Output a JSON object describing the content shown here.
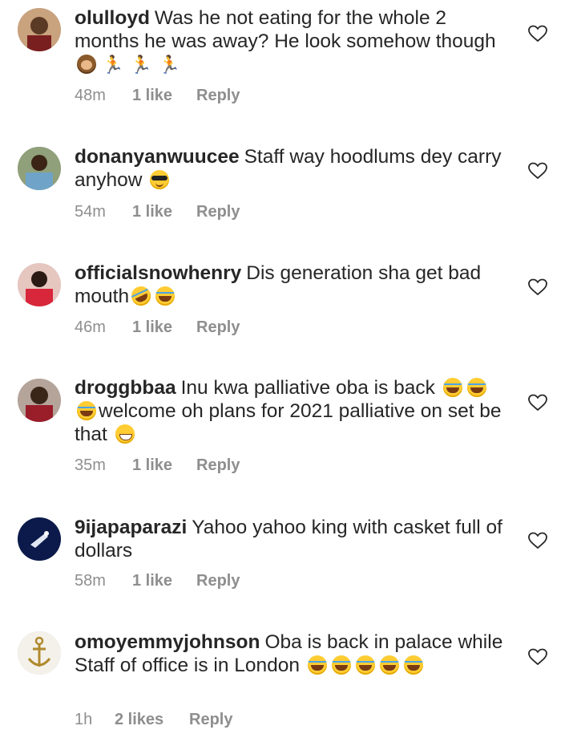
{
  "comments": [
    {
      "user": "olulloyd",
      "text": "Was he not eating for the whole 2 months he was away? He look somehow though",
      "time": "48m",
      "likes": "1 like",
      "reply": "Reply"
    },
    {
      "user": "donanyanwuucee",
      "text": "Staff way hoodlums dey carry anyhow",
      "time": "54m",
      "likes": "1 like",
      "reply": "Reply"
    },
    {
      "user": "officialsnowhenry",
      "text": "Dis generation sha get bad mouth",
      "time": "46m",
      "likes": "1 like",
      "reply": "Reply"
    },
    {
      "user": "droggbbaa",
      "text_a": "Inu kwa palliative oba is back",
      "text_b": "welcome oh plans for 2021 palliative on set be that",
      "time": "35m",
      "likes": "1 like",
      "reply": "Reply"
    },
    {
      "user": "9ijapaparazi",
      "text": "Yahoo yahoo king with casket full of dollars",
      "time": "58m",
      "likes": "1 like",
      "reply": "Reply"
    },
    {
      "user": "omoyemmyjohnson",
      "text": "Oba is back in palace while Staff of office is in London",
      "time": "1h",
      "likes": "2 likes",
      "reply": "Reply"
    }
  ],
  "icons": {
    "heart": "heart-outline-icon",
    "laugh": "face-with-tears-of-joy",
    "rofl": "rolling-on-floor-laughing",
    "cool": "smiling-face-with-sunglasses",
    "grin": "grinning-face",
    "monkey": "see-no-evil-monkey",
    "runner": "person-running"
  },
  "colors": {
    "text": "#262626",
    "meta": "#8e8e8e",
    "background": "#ffffff"
  }
}
